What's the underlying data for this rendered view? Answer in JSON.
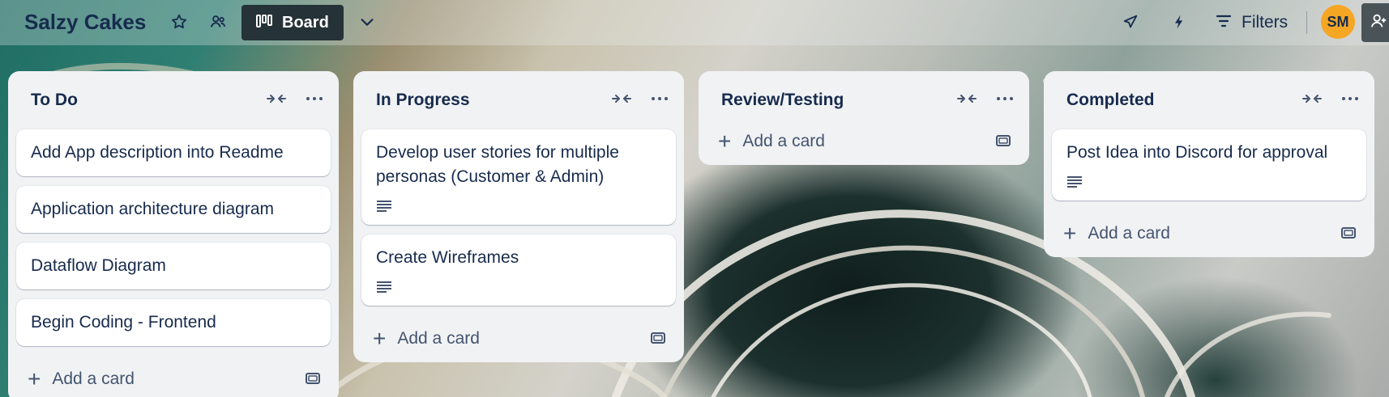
{
  "board": {
    "title": "Salzy Cakes",
    "view_label": "Board",
    "filters_label": "Filters",
    "avatar_initials": "SM"
  },
  "lists": [
    {
      "title": "To Do",
      "cards": [
        {
          "title": "Add App description into Readme",
          "has_description": false
        },
        {
          "title": "Application architecture diagram",
          "has_description": false
        },
        {
          "title": "Dataflow Diagram",
          "has_description": false
        },
        {
          "title": "Begin Coding - Frontend",
          "has_description": false
        }
      ],
      "add_label": "Add a card"
    },
    {
      "title": "In Progress",
      "cards": [
        {
          "title": "Develop user stories for multiple personas (Customer & Admin)",
          "has_description": true
        },
        {
          "title": "Create Wireframes",
          "has_description": true
        }
      ],
      "add_label": "Add a card"
    },
    {
      "title": "Review/Testing",
      "cards": [],
      "add_label": "Add a card"
    },
    {
      "title": "Completed",
      "cards": [
        {
          "title": "Post Idea into Discord for approval",
          "has_description": true
        }
      ],
      "add_label": "Add a card"
    }
  ],
  "colors": {
    "list_bg": "#f1f2f4",
    "text_primary": "#172b4d",
    "avatar_bg": "#f5a623",
    "view_button_bg": "#253238"
  }
}
